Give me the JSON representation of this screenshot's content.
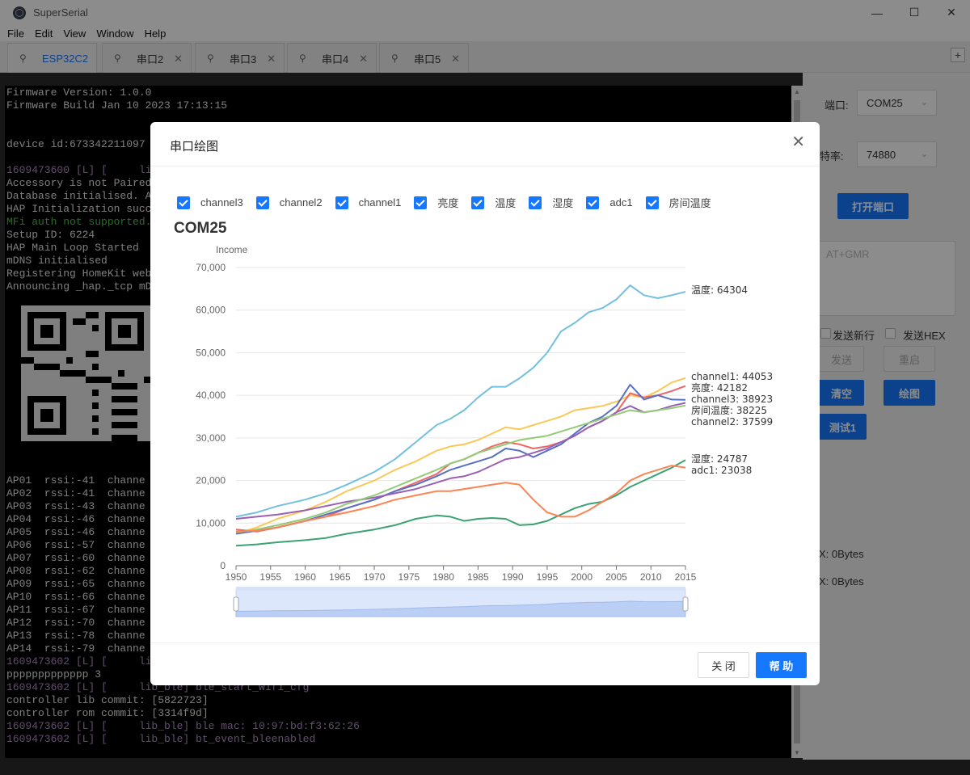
{
  "window": {
    "title": "SuperSerial",
    "minimize": "—",
    "maximize": "☐",
    "close": "✕"
  },
  "menu": [
    "File",
    "Edit",
    "View",
    "Window",
    "Help"
  ],
  "tabs": [
    {
      "label": "ESP32C2",
      "active": true
    },
    {
      "label": "串口2",
      "active": false
    },
    {
      "label": "串口3",
      "active": false
    },
    {
      "label": "串口4",
      "active": false
    },
    {
      "label": "串口5",
      "active": false
    }
  ],
  "tab_add": "+",
  "terminal": {
    "lines": [
      {
        "text": "Firmware Version: 1.0.0",
        "style": "normal"
      },
      {
        "text": "Firmware Build Jan 10 2023 17:13:15",
        "style": "normal"
      },
      {
        "text": "",
        "style": "normal"
      },
      {
        "text": "",
        "style": "normal"
      },
      {
        "text": "device id:673342211097",
        "style": "normal"
      },
      {
        "text": "",
        "style": "normal"
      },
      {
        "text": "1609473600 [L] [     lib",
        "style": "purple"
      },
      {
        "text": "Accessory is not Paired",
        "style": "normal"
      },
      {
        "text": "Database initialised. A",
        "style": "normal"
      },
      {
        "text": "HAP Initialization succ",
        "style": "normal"
      },
      {
        "text": "MFi auth not supported.",
        "style": "green"
      },
      {
        "text": "Setup ID: 6224",
        "style": "normal"
      },
      {
        "text": "HAP Main Loop Started",
        "style": "normal"
      },
      {
        "text": "mDNS initialised",
        "style": "normal"
      },
      {
        "text": "Registering HomeKit web",
        "style": "normal"
      },
      {
        "text": "Announcing _hap._tcp mD",
        "style": "normal"
      }
    ],
    "ap_lines": [
      "AP01  rssi:-41  channe",
      "AP02  rssi:-41  channe",
      "AP03  rssi:-43  channe",
      "AP04  rssi:-46  channe",
      "AP05  rssi:-46  channe",
      "AP06  rssi:-57  channe",
      "AP07  rssi:-60  channe",
      "AP08  rssi:-62  channe",
      "AP09  rssi:-65  channe",
      "AP10  rssi:-66  channe",
      "AP11  rssi:-67  channe",
      "AP12  rssi:-70  channe",
      "AP13  rssi:-78  channe",
      "AP14  rssi:-79  channe"
    ],
    "tail_lines": [
      {
        "text": "1609473602 [L] [     lib",
        "style": "purple"
      },
      {
        "text": "ppppppppppppp 3",
        "style": "normal"
      },
      {
        "text": "1609473602 [L] [     lib_ble] ble_start_wifi_cfg",
        "style": "purple"
      },
      {
        "text": "controller lib commit: [5822723]",
        "style": "normal"
      },
      {
        "text": "controller rom commit: [3314f9d]",
        "style": "normal"
      },
      {
        "text": "1609473602 [L] [     lib_ble] ble mac: 10:97:bd:f3:62:26",
        "style": "purple"
      },
      {
        "text": "1609473602 [L] [     lib_ble] bt_event_bleenabled",
        "style": "purple"
      }
    ]
  },
  "right_panel": {
    "port_label": "端口:",
    "port_value": "COM25",
    "baud_label": "波特率:",
    "baud_value": "74880",
    "open_port_button": "打开端口",
    "input_placeholder": "AT+GMR",
    "send_newline_label": "发送新行",
    "send_hex_label": "发送HEX",
    "send_button": "发送",
    "restart_button": "重启",
    "clear_button": "清空",
    "plot_button": "绘图",
    "test_button": "测试1",
    "rx_label": "X:  0Bytes",
    "tx_label": "X:  0Bytes"
  },
  "modal": {
    "title": "串口绘图",
    "close_icon": "close-icon",
    "footer_close": "关 闭",
    "footer_help": "帮 助"
  },
  "colors": {
    "accent": "#1677ff",
    "温度": "#73c0de",
    "channel1": "#fac858",
    "亮度": "#ee6666",
    "channel3": "#5470c6",
    "房间温度": "#9a60b4",
    "channel2": "#91cc75",
    "湿度": "#3ba272",
    "adc1": "#fc8452"
  },
  "chart_data": {
    "type": "line",
    "title": "COM25",
    "ylabel": "Income",
    "xlabel": "",
    "ylim": [
      0,
      70000
    ],
    "yticks": [
      0,
      10000,
      20000,
      30000,
      40000,
      50000,
      60000,
      70000
    ],
    "ytick_labels": [
      "0",
      "10,000",
      "20,000",
      "30,000",
      "40,000",
      "50,000",
      "60,000",
      "70,000"
    ],
    "xlim": [
      1950,
      2015
    ],
    "xticks": [
      1950,
      1955,
      1960,
      1965,
      1970,
      1975,
      1980,
      1985,
      1990,
      1995,
      2000,
      2005,
      2010,
      2015
    ],
    "legend": [
      "channel3",
      "channel2",
      "channel1",
      "亮度",
      "温度",
      "湿度",
      "adc1",
      "房间温度"
    ],
    "grid": true,
    "has_datazoom_slider": true,
    "end_labels": [
      {
        "series": "温度",
        "text": "温度: 64304"
      },
      {
        "series": "channel1",
        "text": "channel1: 44053"
      },
      {
        "series": "亮度",
        "text": "亮度: 42182"
      },
      {
        "series": "channel3",
        "text": "channel3: 38923"
      },
      {
        "series": "房间温度",
        "text": "房间温度: 38225"
      },
      {
        "series": "channel2",
        "text": "channel2: 37599"
      },
      {
        "series": "湿度",
        "text": "湿度: 24787"
      },
      {
        "series": "adc1",
        "text": "adc1: 23038"
      }
    ],
    "series": [
      {
        "name": "温度",
        "points": [
          [
            1950,
            11500
          ],
          [
            1953,
            12500
          ],
          [
            1956,
            14000
          ],
          [
            1960,
            15500
          ],
          [
            1963,
            17000
          ],
          [
            1966,
            19000
          ],
          [
            1970,
            22000
          ],
          [
            1973,
            25000
          ],
          [
            1976,
            29000
          ],
          [
            1979,
            33000
          ],
          [
            1981,
            34500
          ],
          [
            1983,
            36500
          ],
          [
            1985,
            39500
          ],
          [
            1987,
            42000
          ],
          [
            1989,
            42000
          ],
          [
            1991,
            44000
          ],
          [
            1993,
            46500
          ],
          [
            1995,
            50000
          ],
          [
            1997,
            55000
          ],
          [
            1999,
            57000
          ],
          [
            2001,
            59500
          ],
          [
            2003,
            60500
          ],
          [
            2005,
            62500
          ],
          [
            2007,
            65800
          ],
          [
            2009,
            63500
          ],
          [
            2011,
            62800
          ],
          [
            2013,
            63500
          ],
          [
            2015,
            64304
          ]
        ]
      },
      {
        "name": "channel1",
        "points": [
          [
            1950,
            7500
          ],
          [
            1953,
            9000
          ],
          [
            1956,
            11000
          ],
          [
            1960,
            13000
          ],
          [
            1963,
            15000
          ],
          [
            1966,
            17500
          ],
          [
            1970,
            20000
          ],
          [
            1973,
            22500
          ],
          [
            1976,
            24500
          ],
          [
            1979,
            27000
          ],
          [
            1981,
            28000
          ],
          [
            1983,
            28500
          ],
          [
            1985,
            29500
          ],
          [
            1987,
            31000
          ],
          [
            1989,
            32500
          ],
          [
            1991,
            32000
          ],
          [
            1993,
            33000
          ],
          [
            1995,
            34000
          ],
          [
            1997,
            35000
          ],
          [
            1999,
            36500
          ],
          [
            2001,
            37000
          ],
          [
            2003,
            37500
          ],
          [
            2005,
            38500
          ],
          [
            2007,
            40000
          ],
          [
            2009,
            39500
          ],
          [
            2011,
            41000
          ],
          [
            2013,
            43000
          ],
          [
            2015,
            44053
          ]
        ]
      },
      {
        "name": "亮度",
        "points": [
          [
            1950,
            8500
          ],
          [
            1953,
            8000
          ],
          [
            1956,
            9000
          ],
          [
            1960,
            10500
          ],
          [
            1963,
            11500
          ],
          [
            1966,
            13500
          ],
          [
            1970,
            15500
          ],
          [
            1973,
            17500
          ],
          [
            1976,
            19500
          ],
          [
            1979,
            21500
          ],
          [
            1981,
            24000
          ],
          [
            1983,
            25000
          ],
          [
            1985,
            26500
          ],
          [
            1987,
            28000
          ],
          [
            1989,
            29000
          ],
          [
            1991,
            28500
          ],
          [
            1993,
            27500
          ],
          [
            1995,
            28000
          ],
          [
            1997,
            29000
          ],
          [
            1999,
            30500
          ],
          [
            2001,
            32500
          ],
          [
            2003,
            34000
          ],
          [
            2005,
            36000
          ],
          [
            2007,
            40500
          ],
          [
            2009,
            39500
          ],
          [
            2011,
            40000
          ],
          [
            2013,
            41000
          ],
          [
            2015,
            42182
          ]
        ]
      },
      {
        "name": "channel3",
        "points": [
          [
            1950,
            7500
          ],
          [
            1953,
            8200
          ],
          [
            1956,
            9000
          ],
          [
            1960,
            10500
          ],
          [
            1963,
            12000
          ],
          [
            1966,
            13500
          ],
          [
            1970,
            15500
          ],
          [
            1973,
            17500
          ],
          [
            1976,
            19000
          ],
          [
            1979,
            21000
          ],
          [
            1981,
            22500
          ],
          [
            1983,
            23500
          ],
          [
            1985,
            24500
          ],
          [
            1987,
            25500
          ],
          [
            1989,
            27500
          ],
          [
            1991,
            27000
          ],
          [
            1993,
            25500
          ],
          [
            1995,
            27000
          ],
          [
            1997,
            28500
          ],
          [
            1999,
            31000
          ],
          [
            2001,
            33500
          ],
          [
            2003,
            35000
          ],
          [
            2005,
            37500
          ],
          [
            2007,
            42500
          ],
          [
            2009,
            39000
          ],
          [
            2011,
            40000
          ],
          [
            2013,
            39000
          ],
          [
            2015,
            38923
          ]
        ]
      },
      {
        "name": "房间温度",
        "points": [
          [
            1950,
            11000
          ],
          [
            1953,
            11500
          ],
          [
            1956,
            12000
          ],
          [
            1960,
            13000
          ],
          [
            1963,
            14000
          ],
          [
            1966,
            15000
          ],
          [
            1970,
            16000
          ],
          [
            1973,
            17000
          ],
          [
            1976,
            18000
          ],
          [
            1979,
            19500
          ],
          [
            1981,
            20500
          ],
          [
            1983,
            21000
          ],
          [
            1985,
            22000
          ],
          [
            1987,
            23500
          ],
          [
            1989,
            25000
          ],
          [
            1991,
            25500
          ],
          [
            1993,
            26500
          ],
          [
            1995,
            27500
          ],
          [
            1997,
            29000
          ],
          [
            1999,
            30500
          ],
          [
            2001,
            32500
          ],
          [
            2003,
            34000
          ],
          [
            2005,
            36000
          ],
          [
            2007,
            37500
          ],
          [
            2009,
            36000
          ],
          [
            2011,
            36500
          ],
          [
            2013,
            37500
          ],
          [
            2015,
            38225
          ]
        ]
      },
      {
        "name": "channel2",
        "points": [
          [
            1950,
            7800
          ],
          [
            1953,
            8500
          ],
          [
            1956,
            9500
          ],
          [
            1960,
            11000
          ],
          [
            1963,
            12500
          ],
          [
            1966,
            14500
          ],
          [
            1970,
            16500
          ],
          [
            1973,
            18500
          ],
          [
            1976,
            20500
          ],
          [
            1979,
            22500
          ],
          [
            1981,
            24000
          ],
          [
            1983,
            25000
          ],
          [
            1985,
            26500
          ],
          [
            1987,
            27500
          ],
          [
            1989,
            28500
          ],
          [
            1991,
            29500
          ],
          [
            1993,
            30000
          ],
          [
            1995,
            30500
          ],
          [
            1997,
            31500
          ],
          [
            1999,
            32500
          ],
          [
            2001,
            33500
          ],
          [
            2003,
            34500
          ],
          [
            2005,
            35500
          ],
          [
            2007,
            36500
          ],
          [
            2009,
            36000
          ],
          [
            2011,
            36500
          ],
          [
            2013,
            37000
          ],
          [
            2015,
            37599
          ]
        ]
      },
      {
        "name": "湿度",
        "points": [
          [
            1950,
            4700
          ],
          [
            1953,
            5000
          ],
          [
            1956,
            5500
          ],
          [
            1960,
            6000
          ],
          [
            1963,
            6500
          ],
          [
            1966,
            7500
          ],
          [
            1970,
            8500
          ],
          [
            1973,
            9500
          ],
          [
            1976,
            11000
          ],
          [
            1979,
            11800
          ],
          [
            1981,
            11500
          ],
          [
            1983,
            10500
          ],
          [
            1985,
            11000
          ],
          [
            1987,
            11200
          ],
          [
            1989,
            11000
          ],
          [
            1991,
            9500
          ],
          [
            1993,
            9700
          ],
          [
            1995,
            10500
          ],
          [
            1997,
            12000
          ],
          [
            1999,
            13500
          ],
          [
            2001,
            14500
          ],
          [
            2003,
            15000
          ],
          [
            2005,
            16500
          ],
          [
            2007,
            18500
          ],
          [
            2009,
            20000
          ],
          [
            2011,
            21500
          ],
          [
            2013,
            23000
          ],
          [
            2015,
            24787
          ]
        ]
      },
      {
        "name": "adc1",
        "points": [
          [
            1950,
            8000
          ],
          [
            1953,
            8200
          ],
          [
            1956,
            9000
          ],
          [
            1960,
            10500
          ],
          [
            1963,
            11500
          ],
          [
            1966,
            12500
          ],
          [
            1970,
            14000
          ],
          [
            1973,
            15500
          ],
          [
            1976,
            16500
          ],
          [
            1979,
            17500
          ],
          [
            1981,
            17500
          ],
          [
            1983,
            18000
          ],
          [
            1985,
            18500
          ],
          [
            1987,
            19000
          ],
          [
            1989,
            19500
          ],
          [
            1991,
            19000
          ],
          [
            1993,
            15500
          ],
          [
            1995,
            12500
          ],
          [
            1997,
            11500
          ],
          [
            1999,
            11500
          ],
          [
            2001,
            13000
          ],
          [
            2003,
            15000
          ],
          [
            2005,
            17000
          ],
          [
            2007,
            20000
          ],
          [
            2009,
            21500
          ],
          [
            2011,
            22500
          ],
          [
            2013,
            23500
          ],
          [
            2015,
            23038
          ]
        ]
      }
    ]
  }
}
